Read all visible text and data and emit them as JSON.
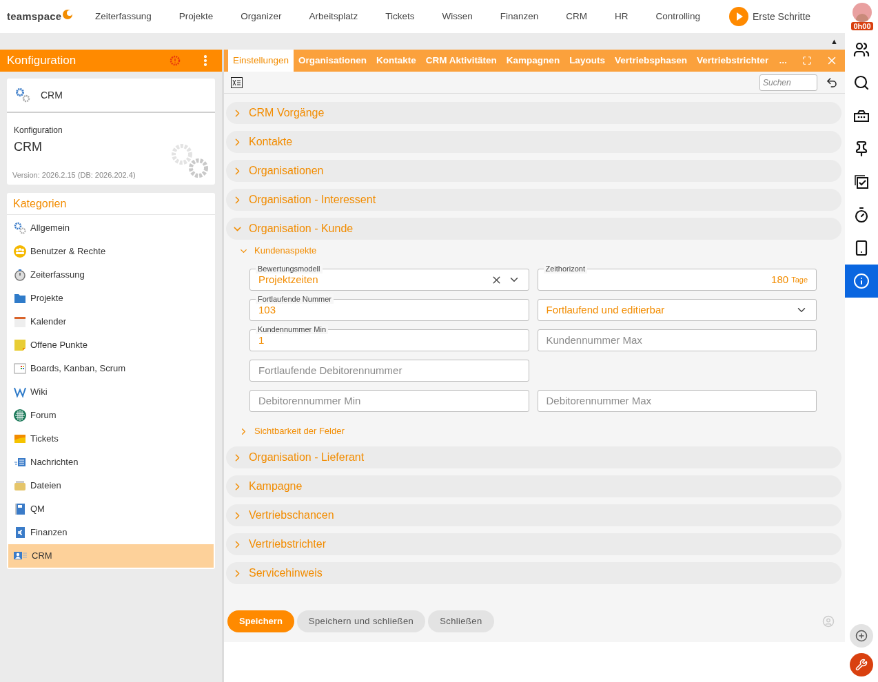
{
  "logo": {
    "text": "teamspace"
  },
  "nav": [
    {
      "label": "Zeiterfassung"
    },
    {
      "label": "Projekte"
    },
    {
      "label": "Organizer"
    },
    {
      "label": "Arbeitsplatz"
    },
    {
      "label": "Tickets"
    },
    {
      "label": "Wissen"
    },
    {
      "label": "Finanzen"
    },
    {
      "label": "CRM"
    },
    {
      "label": "HR"
    },
    {
      "label": "Controlling"
    }
  ],
  "start_button": {
    "label": "Erste Schritte"
  },
  "avatar": {
    "badge": "0h00"
  },
  "scroll_up": "▲",
  "left_panel": {
    "title": "Konfiguration",
    "module": {
      "name": "CRM"
    },
    "info": {
      "label": "Konfiguration",
      "title": "CRM",
      "version": "Version: 2026.2.15 (DB: 2026.202.4)"
    },
    "categories": {
      "title": "Kategorien",
      "items": [
        {
          "label": "Allgemein",
          "selected": false
        },
        {
          "label": "Benutzer & Rechte",
          "selected": false
        },
        {
          "label": "Zeiterfassung",
          "selected": false
        },
        {
          "label": "Projekte",
          "selected": false
        },
        {
          "label": "Kalender",
          "selected": false
        },
        {
          "label": "Offene Punkte",
          "selected": false
        },
        {
          "label": "Boards, Kanban, Scrum",
          "selected": false
        },
        {
          "label": "Wiki",
          "selected": false
        },
        {
          "label": "Forum",
          "selected": false
        },
        {
          "label": "Tickets",
          "selected": false
        },
        {
          "label": "Nachrichten",
          "selected": false
        },
        {
          "label": "Dateien",
          "selected": false
        },
        {
          "label": "QM",
          "selected": false
        },
        {
          "label": "Finanzen",
          "selected": false
        },
        {
          "label": "CRM",
          "selected": true
        }
      ]
    }
  },
  "tabs": [
    {
      "label": "Einstellungen",
      "selected": true
    },
    {
      "label": "Organisationen",
      "selected": false
    },
    {
      "label": "Kontakte",
      "selected": false
    },
    {
      "label": "CRM Aktivitäten",
      "selected": false
    },
    {
      "label": "Kampagnen",
      "selected": false
    },
    {
      "label": "Layouts",
      "selected": false
    },
    {
      "label": "Vertriebsphasen",
      "selected": false
    },
    {
      "label": "Vertriebstrichter",
      "selected": false
    }
  ],
  "tabs_more": "…",
  "search": {
    "placeholder": "Suchen"
  },
  "sections": [
    {
      "title": "CRM Vorgänge",
      "expanded": false
    },
    {
      "title": "Kontakte",
      "expanded": false
    },
    {
      "title": "Organisationen",
      "expanded": false
    },
    {
      "title": "Organisation - Interessent",
      "expanded": false
    },
    {
      "title": "Organisation - Kunde",
      "expanded": true,
      "subsections": [
        {
          "title": "Kundenaspekte",
          "expanded": true,
          "rows": [
            [
              {
                "kind": "select",
                "label": "Bewertungsmodell",
                "value": "Projektzeiten"
              },
              {
                "kind": "number",
                "label": "Zeithorizont",
                "value": "180",
                "unit": "Tage"
              }
            ],
            [
              {
                "kind": "text",
                "label": "Fortlaufende Nummer",
                "value": "103"
              },
              {
                "kind": "dropdown",
                "value": "Fortlaufend und editierbar"
              }
            ],
            [
              {
                "kind": "text",
                "label": "Kundennummer Min",
                "value": "1"
              },
              {
                "kind": "text",
                "placeholder": "Kundennummer Max"
              }
            ],
            [
              {
                "kind": "text",
                "placeholder": "Fortlaufende Debitorennummer"
              }
            ],
            [
              {
                "kind": "text",
                "placeholder": "Debitorennummer Min"
              },
              {
                "kind": "text",
                "placeholder": "Debitorennummer Max"
              }
            ]
          ]
        },
        {
          "title": "Sichtbarkeit der Felder",
          "expanded": false
        }
      ]
    },
    {
      "title": "Organisation - Lieferant",
      "expanded": false
    },
    {
      "title": "Kampagne",
      "expanded": false
    },
    {
      "title": "Vertriebschancen",
      "expanded": false
    },
    {
      "title": "Vertriebstrichter",
      "expanded": false
    },
    {
      "title": "Servicehinweis",
      "expanded": false
    }
  ],
  "buttons": [
    {
      "label": "Speichern",
      "kind": "primary"
    },
    {
      "label": "Speichern und schließen",
      "kind": "secondary"
    },
    {
      "label": "Schließen",
      "kind": "secondary"
    }
  ]
}
